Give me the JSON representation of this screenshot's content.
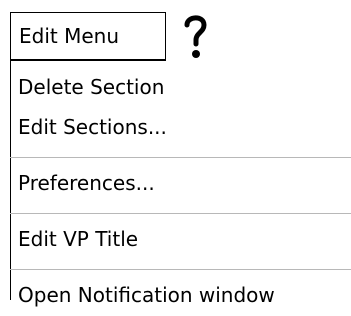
{
  "menu": {
    "title": "Edit Menu",
    "help_icon": "question-mark-icon",
    "items": [
      {
        "label": "Delete Section"
      },
      {
        "label": "Edit Sections..."
      },
      {
        "label": "Preferences..."
      },
      {
        "label": "Edit VP Title"
      },
      {
        "label": "Open Notification window"
      }
    ]
  }
}
